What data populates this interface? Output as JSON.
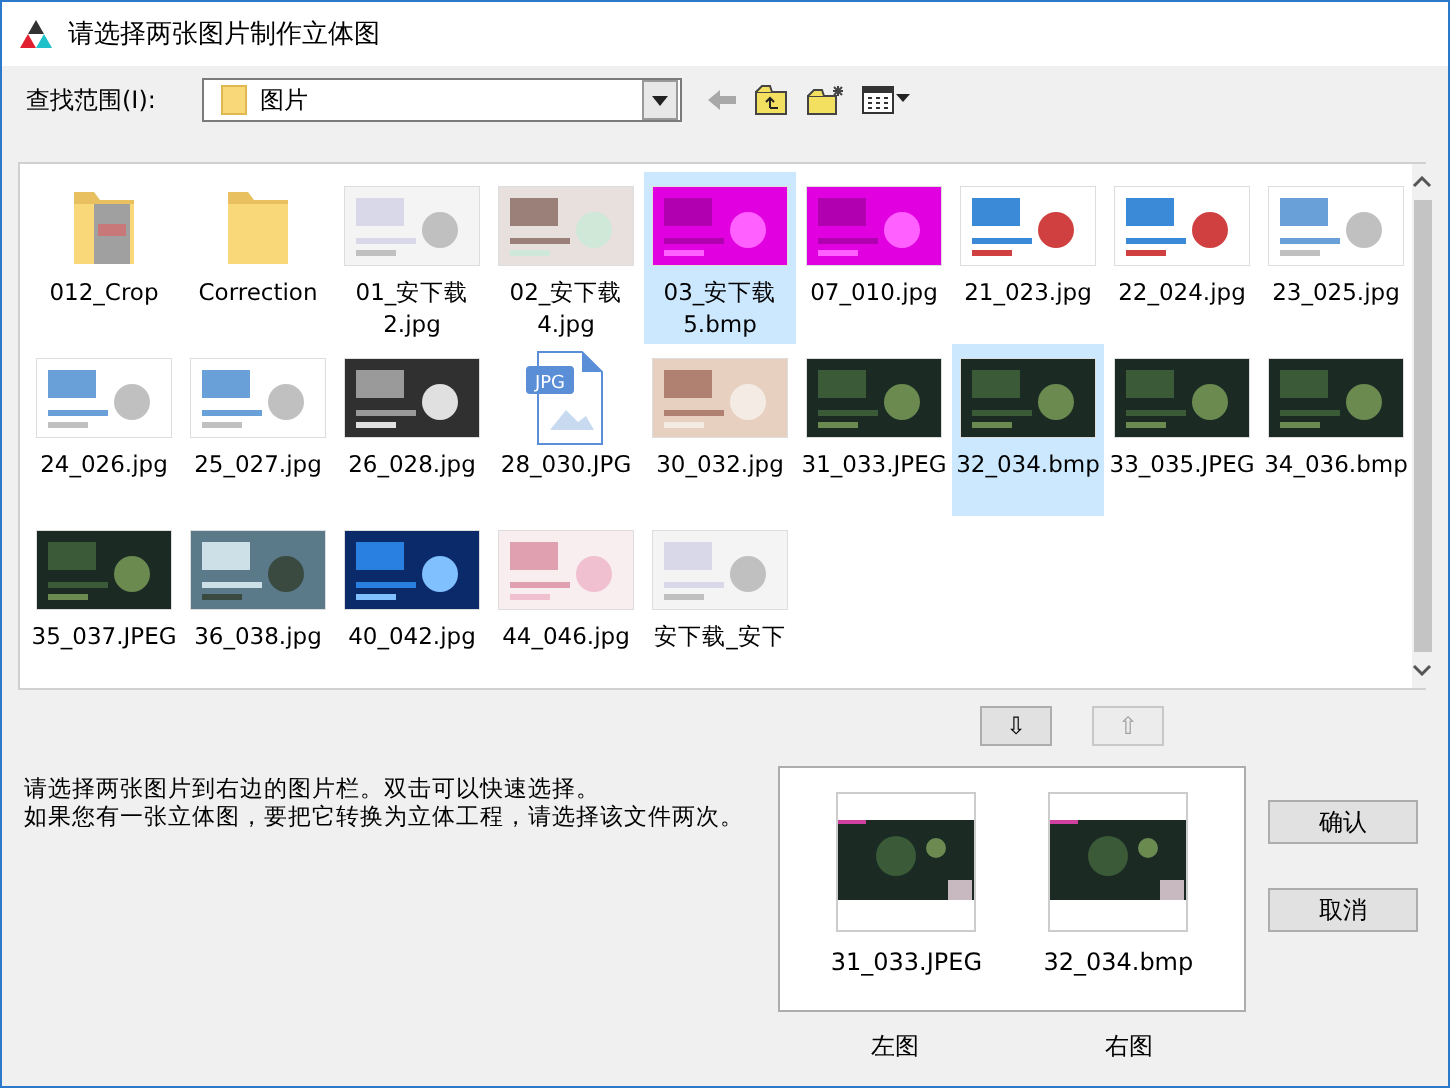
{
  "window": {
    "title": "请选择两张图片制作立体图"
  },
  "toolbar": {
    "label": "查找范围(I):",
    "location": "图片"
  },
  "files": [
    {
      "label": "012_Crop",
      "kind": "folder",
      "selected": false
    },
    {
      "label": "Correction",
      "kind": "folder",
      "selected": false
    },
    {
      "label": "01_安下载2.jpg",
      "kind": "picture",
      "selected": false
    },
    {
      "label": "02_安下载4.jpg",
      "kind": "picture",
      "selected": false
    },
    {
      "label": "03_安下载5.bmp",
      "kind": "picture",
      "selected": true
    },
    {
      "label": "07_010.jpg",
      "kind": "picture",
      "selected": false
    },
    {
      "label": "21_023.jpg",
      "kind": "picture",
      "selected": false
    },
    {
      "label": "22_024.jpg",
      "kind": "picture",
      "selected": false
    },
    {
      "label": "23_025.jpg",
      "kind": "picture",
      "selected": false
    },
    {
      "label": "24_026.jpg",
      "kind": "picture",
      "selected": false
    },
    {
      "label": "25_027.jpg",
      "kind": "picture",
      "selected": false
    },
    {
      "label": "26_028.jpg",
      "kind": "picture",
      "selected": false
    },
    {
      "label": "28_030.JPG",
      "kind": "file-icon",
      "badge": "JPG",
      "selected": false
    },
    {
      "label": "30_032.jpg",
      "kind": "picture",
      "selected": false
    },
    {
      "label": "31_033.JPEG",
      "kind": "picture",
      "selected": false
    },
    {
      "label": "32_034.bmp",
      "kind": "picture",
      "selected": true
    },
    {
      "label": "33_035.JPEG",
      "kind": "picture",
      "selected": false
    },
    {
      "label": "34_036.bmp",
      "kind": "picture",
      "selected": false
    },
    {
      "label": "35_037.JPEG",
      "kind": "picture",
      "selected": false
    },
    {
      "label": "36_038.jpg",
      "kind": "picture",
      "selected": false
    },
    {
      "label": "40_042.jpg",
      "kind": "picture",
      "selected": false
    },
    {
      "label": "44_046.jpg",
      "kind": "picture",
      "selected": false
    },
    {
      "label": "安下载_安下",
      "kind": "picture",
      "selected": false
    }
  ],
  "move_buttons": [
    {
      "label": "⇩",
      "disabled": false
    },
    {
      "label": "⇧",
      "disabled": true
    }
  ],
  "instructions": [
    "请选择两张图片到右边的图片栏。双击可以快速选择。",
    "如果您有一张立体图，要把它转换为立体工程，请选择该文件两次。"
  ],
  "preview": [
    {
      "label": "31_033.JPEG",
      "caption": "左图"
    },
    {
      "label": "32_034.bmp",
      "caption": "右图"
    }
  ],
  "buttons": [
    "确认",
    "取消"
  ]
}
